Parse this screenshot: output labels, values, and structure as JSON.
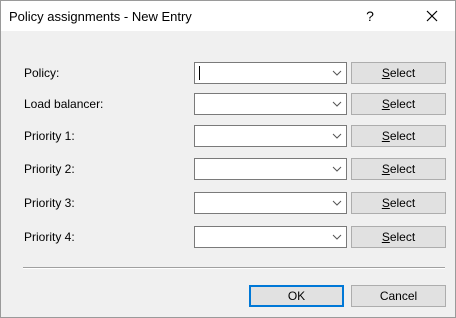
{
  "window": {
    "title": "Policy assignments - New Entry",
    "help_label": "?",
    "close_icon": "close-icon"
  },
  "fields": [
    {
      "label": "Policy:",
      "value": "",
      "select_label": "Select",
      "focused": true
    },
    {
      "label": "Load balancer:",
      "value": "",
      "select_label": "Select",
      "focused": false
    },
    {
      "label": "Priority 1:",
      "value": "",
      "select_label": "Select",
      "focused": false
    },
    {
      "label": "Priority 2:",
      "value": "",
      "select_label": "Select",
      "focused": false
    },
    {
      "label": "Priority 3:",
      "value": "",
      "select_label": "Select",
      "focused": false
    },
    {
      "label": "Priority 4:",
      "value": "",
      "select_label": "Select",
      "focused": false
    }
  ],
  "footer": {
    "ok_label": "OK",
    "cancel_label": "Cancel"
  },
  "colors": {
    "accent": "#0078d7",
    "dialog_bg": "#f0f0f0",
    "button_bg": "#e1e1e1"
  }
}
